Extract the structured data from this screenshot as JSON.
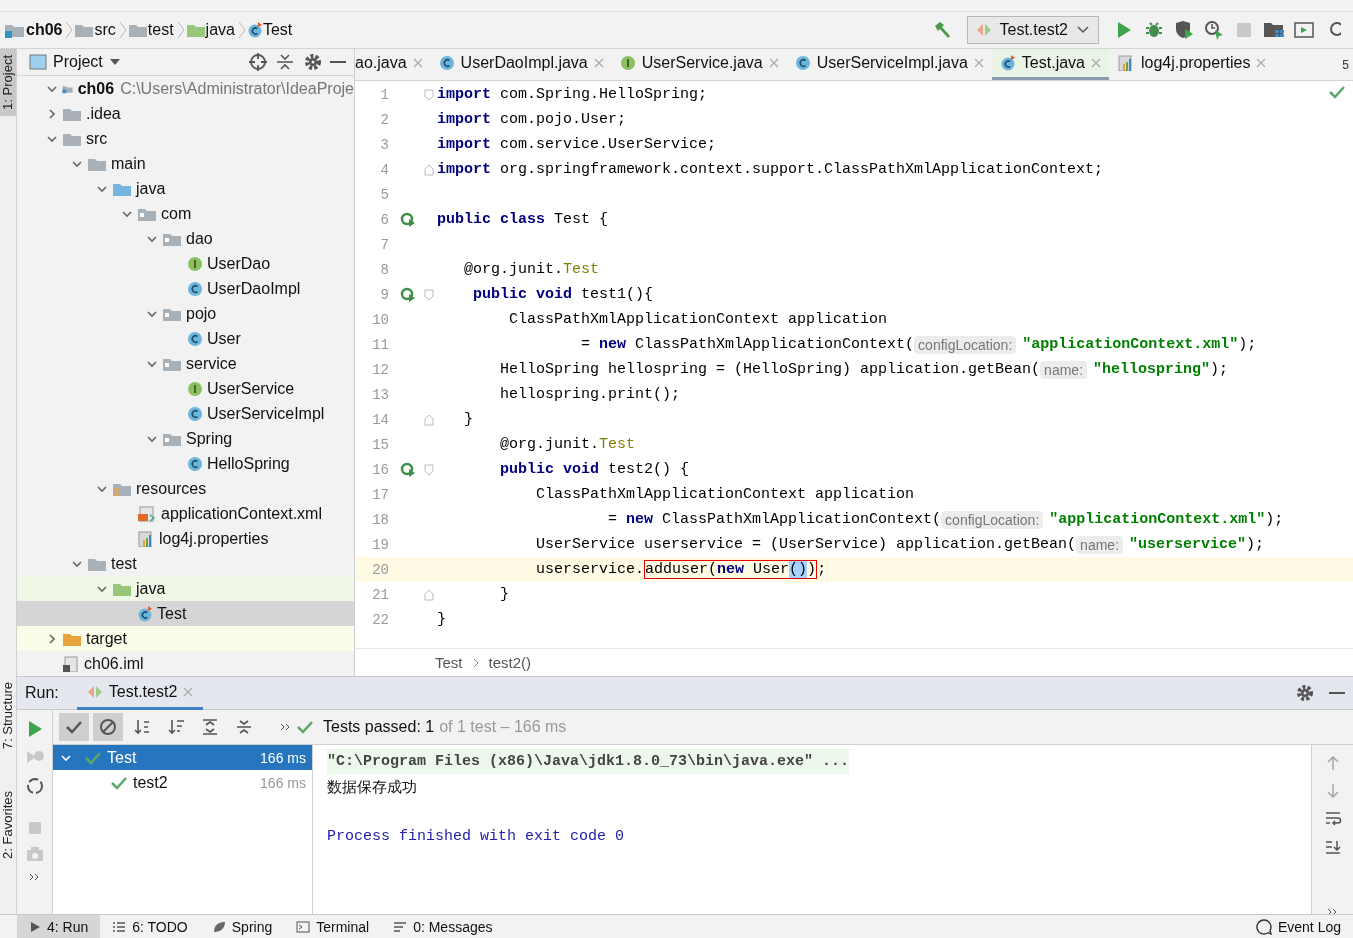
{
  "navbar": {
    "crumbs": [
      {
        "label": "ch06",
        "kind": "module"
      },
      {
        "label": "src",
        "kind": "folder"
      },
      {
        "label": "test",
        "kind": "folder"
      },
      {
        "label": "java",
        "kind": "test-source"
      },
      {
        "label": "Test",
        "kind": "test-class"
      }
    ],
    "run_config": "Test.test2"
  },
  "left_strip": [
    {
      "label": "1: Project",
      "selected": true
    },
    {
      "label": "7: Structure",
      "selected": false
    },
    {
      "label": "2: Favorites",
      "selected": false
    }
  ],
  "project": {
    "title": "Project",
    "tree": [
      {
        "label": "ch06",
        "path": "C:\\Users\\Administrator\\IdeaProje",
        "kind": "module",
        "expanded": true,
        "selected": false,
        "children": [
          {
            "label": ".idea",
            "kind": "folder",
            "expanded": false,
            "selected": false
          },
          {
            "label": "src",
            "kind": "folder",
            "expanded": true,
            "selected": false,
            "children": [
              {
                "label": "main",
                "kind": "folder",
                "expanded": true,
                "selected": false,
                "children": [
                  {
                    "label": "java",
                    "kind": "source",
                    "expanded": true,
                    "selected": false,
                    "children": [
                      {
                        "label": "com",
                        "kind": "package",
                        "expanded": true,
                        "selected": false,
                        "children": [
                          {
                            "label": "dao",
                            "kind": "package",
                            "expanded": true,
                            "selected": false,
                            "children": [
                              {
                                "label": "UserDao",
                                "kind": "interface",
                                "selected": false
                              },
                              {
                                "label": "UserDaoImpl",
                                "kind": "class",
                                "selected": false
                              }
                            ]
                          },
                          {
                            "label": "pojo",
                            "kind": "package",
                            "expanded": true,
                            "selected": false,
                            "children": [
                              {
                                "label": "User",
                                "kind": "class",
                                "selected": false
                              }
                            ]
                          },
                          {
                            "label": "service",
                            "kind": "package",
                            "expanded": true,
                            "selected": false,
                            "children": [
                              {
                                "label": "UserService",
                                "kind": "interface",
                                "selected": false
                              },
                              {
                                "label": "UserServiceImpl",
                                "kind": "class",
                                "selected": false
                              }
                            ]
                          },
                          {
                            "label": "Spring",
                            "kind": "package",
                            "expanded": true,
                            "selected": false,
                            "children": [
                              {
                                "label": "HelloSpring",
                                "kind": "class",
                                "selected": false
                              }
                            ]
                          }
                        ]
                      }
                    ]
                  },
                  {
                    "label": "resources",
                    "kind": "resources",
                    "expanded": true,
                    "selected": false,
                    "children": [
                      {
                        "label": "applicationContext.xml",
                        "kind": "xml",
                        "selected": false
                      },
                      {
                        "label": "log4j.properties",
                        "kind": "properties",
                        "selected": false
                      }
                    ]
                  }
                ]
              },
              {
                "label": "test",
                "kind": "folder",
                "expanded": true,
                "selected": false,
                "children": [
                  {
                    "label": "java",
                    "kind": "test-source",
                    "expanded": true,
                    "selected": false,
                    "children": [
                      {
                        "label": "Test",
                        "kind": "test-class",
                        "selected": true
                      }
                    ]
                  }
                ]
              }
            ]
          },
          {
            "label": "target",
            "kind": "excluded",
            "expanded": false,
            "selected": false
          },
          {
            "label": "ch06.iml",
            "kind": "iml",
            "selected": false
          }
        ]
      }
    ]
  },
  "editor": {
    "tabs": [
      {
        "label": "ao.java",
        "kind": "partial",
        "selected": false
      },
      {
        "label": "UserDaoImpl.java",
        "kind": "class",
        "selected": false
      },
      {
        "label": "UserService.java",
        "kind": "interface",
        "selected": false
      },
      {
        "label": "UserServiceImpl.java",
        "kind": "class",
        "selected": false
      },
      {
        "label": "Test.java",
        "kind": "test-class",
        "selected": true
      },
      {
        "label": "log4j.properties",
        "kind": "properties",
        "selected": false
      }
    ],
    "tab_count": "5",
    "lines": [
      {
        "number": "1",
        "run_marker": false,
        "fold_start": true,
        "fold_end": false,
        "current": false,
        "tokens": [
          {
            "kind": "keyword",
            "text": "import"
          },
          {
            "kind": "plain",
            "text": " com.Spring.HelloSpring;"
          }
        ]
      },
      {
        "number": "2",
        "run_marker": false,
        "fold_start": false,
        "fold_end": false,
        "current": false,
        "tokens": [
          {
            "kind": "keyword",
            "text": "import"
          },
          {
            "kind": "plain",
            "text": " com.pojo.User;"
          }
        ]
      },
      {
        "number": "3",
        "run_marker": false,
        "fold_start": false,
        "fold_end": false,
        "current": false,
        "tokens": [
          {
            "kind": "keyword",
            "text": "import"
          },
          {
            "kind": "plain",
            "text": " com.service.UserService;"
          }
        ]
      },
      {
        "number": "4",
        "run_marker": false,
        "fold_start": false,
        "fold_end": true,
        "current": false,
        "tokens": [
          {
            "kind": "keyword",
            "text": "import"
          },
          {
            "kind": "plain",
            "text": " org.springframework.context.support.ClassPathXmlApplicationContext;"
          }
        ]
      },
      {
        "number": "5",
        "run_marker": false,
        "fold_start": false,
        "fold_end": false,
        "current": false
      },
      {
        "number": "6",
        "run_marker": true,
        "fold_start": false,
        "fold_end": false,
        "current": false,
        "tokens": [
          {
            "kind": "keyword",
            "text": "public class"
          },
          {
            "kind": "plain",
            "text": " Test {"
          }
        ]
      },
      {
        "number": "7",
        "run_marker": false,
        "fold_start": false,
        "fold_end": false,
        "current": false
      },
      {
        "number": "8",
        "run_marker": false,
        "fold_start": false,
        "fold_end": false,
        "current": false,
        "tokens": [
          {
            "kind": "plain",
            "text": "   @org.junit."
          },
          {
            "kind": "annotation",
            "text": "Test"
          }
        ]
      },
      {
        "number": "9",
        "run_marker": true,
        "fold_start": true,
        "fold_end": false,
        "current": false,
        "tokens": [
          {
            "kind": "keyword",
            "text": "    public void"
          },
          {
            "kind": "plain",
            "text": " test1(){"
          }
        ]
      },
      {
        "number": "10",
        "run_marker": false,
        "fold_start": false,
        "fold_end": false,
        "current": false,
        "tokens": [
          {
            "kind": "plain",
            "text": "        ClassPathXmlApplicationContext application"
          }
        ]
      },
      {
        "number": "11",
        "run_marker": false,
        "fold_start": false,
        "fold_end": false,
        "current": false,
        "tokens": [
          {
            "kind": "plain",
            "text": "                = "
          },
          {
            "kind": "keyword",
            "text": "new"
          },
          {
            "kind": "plain",
            "text": " ClassPathXmlApplicationContext("
          },
          {
            "kind": "hint",
            "text": "configLocation:"
          },
          {
            "kind": "string",
            "text": "\"applicationContext.xml\""
          },
          {
            "kind": "plain",
            "text": ");"
          }
        ]
      },
      {
        "number": "12",
        "run_marker": false,
        "fold_start": false,
        "fold_end": false,
        "current": false,
        "tokens": [
          {
            "kind": "plain",
            "text": "       HelloSpring hellospring = (HelloSpring) application.getBean("
          },
          {
            "kind": "hint",
            "text": "name:"
          },
          {
            "kind": "string",
            "text": "\"hellospring\""
          },
          {
            "kind": "plain",
            "text": ");"
          }
        ]
      },
      {
        "number": "13",
        "run_marker": false,
        "fold_start": false,
        "fold_end": false,
        "current": false,
        "tokens": [
          {
            "kind": "plain",
            "text": "       hellospring.print();"
          }
        ]
      },
      {
        "number": "14",
        "run_marker": false,
        "fold_start": false,
        "fold_end": true,
        "current": false,
        "tokens": [
          {
            "kind": "plain",
            "text": "   }"
          }
        ]
      },
      {
        "number": "15",
        "run_marker": false,
        "fold_start": false,
        "fold_end": false,
        "current": false,
        "tokens": [
          {
            "kind": "plain",
            "text": "       @org.junit."
          },
          {
            "kind": "annotation",
            "text": "Test"
          }
        ]
      },
      {
        "number": "16",
        "run_marker": true,
        "fold_start": true,
        "fold_end": false,
        "current": false,
        "tokens": [
          {
            "kind": "keyword",
            "text": "       public void"
          },
          {
            "kind": "plain",
            "text": " test2() {"
          }
        ]
      },
      {
        "number": "17",
        "run_marker": false,
        "fold_start": false,
        "fold_end": false,
        "current": false,
        "tokens": [
          {
            "kind": "plain",
            "text": "           ClassPathXmlApplicationContext application"
          }
        ]
      },
      {
        "number": "18",
        "run_marker": false,
        "fold_start": false,
        "fold_end": false,
        "current": false,
        "tokens": [
          {
            "kind": "plain",
            "text": "                   = "
          },
          {
            "kind": "keyword",
            "text": "new"
          },
          {
            "kind": "plain",
            "text": " ClassPathXmlApplicationContext("
          },
          {
            "kind": "hint",
            "text": "configLocation:"
          },
          {
            "kind": "string",
            "text": "\"applicationContext.xml\""
          },
          {
            "kind": "plain",
            "text": ");"
          }
        ]
      },
      {
        "number": "19",
        "run_marker": false,
        "fold_start": false,
        "fold_end": false,
        "current": false,
        "tokens": [
          {
            "kind": "plain",
            "text": "           UserService userservice = (UserService) application.getBean("
          },
          {
            "kind": "hint",
            "text": "name:"
          },
          {
            "kind": "string",
            "text": "\"userservice\""
          },
          {
            "kind": "plain",
            "text": ");"
          }
        ]
      },
      {
        "number": "20",
        "run_marker": false,
        "fold_start": false,
        "fold_end": false,
        "current": true,
        "tokens": [
          {
            "kind": "plain",
            "text": "           userservice."
          },
          {
            "kind": "box",
            "tokens": [
              {
                "kind": "plain",
                "text": "adduser("
              },
              {
                "kind": "keyword",
                "text": "new"
              },
              {
                "kind": "plain",
                "text": " User"
              },
              {
                "kind": "selected",
                "text": "()"
              },
              {
                "kind": "plain",
                "text": ")"
              }
            ]
          },
          {
            "kind": "plain",
            "text": ";"
          }
        ]
      },
      {
        "number": "21",
        "run_marker": false,
        "fold_start": false,
        "fold_end": true,
        "current": false,
        "tokens": [
          {
            "kind": "plain",
            "text": "       }"
          }
        ]
      },
      {
        "number": "22",
        "run_marker": false,
        "fold_start": false,
        "fold_end": false,
        "current": false,
        "tokens": [
          {
            "kind": "plain",
            "text": "}"
          }
        ]
      }
    ],
    "breadcrumbs": [
      "Test",
      "test2()"
    ]
  },
  "run": {
    "label": "Run:",
    "tab": "Test.test2",
    "status": {
      "label": "Tests passed:",
      "count": "1",
      "detail": "of 1 test – 166 ms"
    },
    "tests": [
      {
        "name": "Test",
        "time": "166 ms",
        "selected": true,
        "expanded": true,
        "children": [
          {
            "name": "test2",
            "time": "166 ms",
            "selected": false
          }
        ]
      }
    ],
    "console": [
      {
        "kind": "command",
        "text": "\"C:\\Program Files (x86)\\Java\\jdk1.8.0_73\\bin\\java.exe\" ..."
      },
      {
        "kind": "output",
        "text": "数据保存成功"
      },
      {
        "kind": "exit",
        "text": "Process finished with exit code 0"
      }
    ]
  },
  "bottom_bar": {
    "tools": [
      {
        "label": "4: Run",
        "kind": "run",
        "selected": true
      },
      {
        "label": "6: TODO",
        "kind": "list",
        "selected": false
      },
      {
        "label": "Spring",
        "kind": "leaf",
        "selected": false
      },
      {
        "label": "Terminal",
        "kind": "terminal",
        "selected": false
      },
      {
        "label": "0: Messages",
        "kind": "messages",
        "selected": false
      }
    ],
    "event_log": "Event Log"
  }
}
